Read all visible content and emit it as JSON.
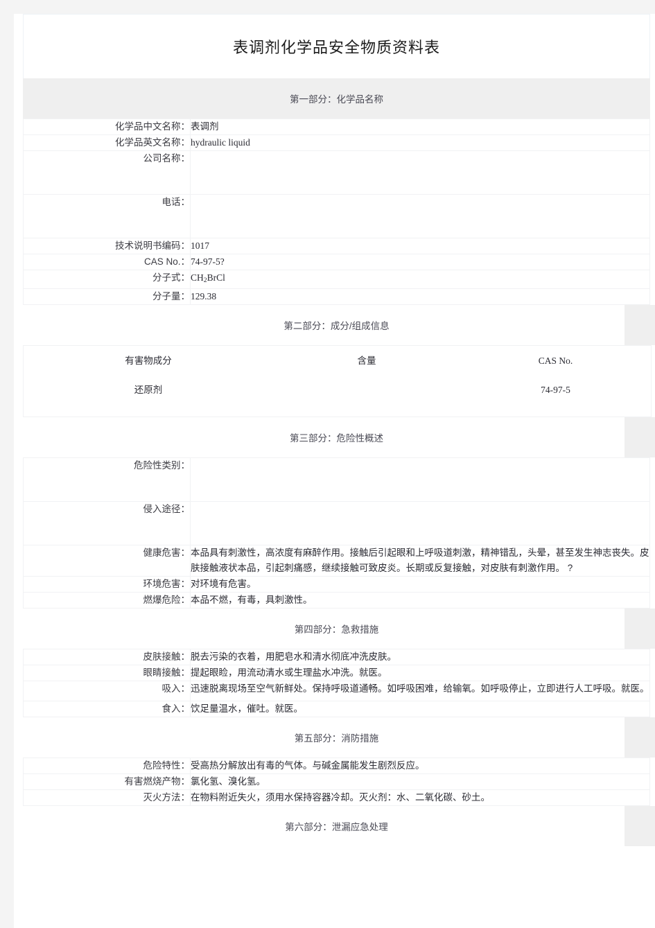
{
  "document": {
    "title": "表调剂化学品安全物质资料表"
  },
  "sections": [
    {
      "heading": "第一部分：化学品名称",
      "style": "filled",
      "rows": [
        {
          "label": "化学品中文名称：",
          "value": "表调剂",
          "size": "short",
          "latin": false
        },
        {
          "label": "化学品英文名称：",
          "value": "hydraulic  liquid",
          "size": "short",
          "latin": true
        },
        {
          "label": "公司名称：",
          "value": "",
          "size": "tall",
          "latin": false
        },
        {
          "label": "电话：",
          "value": "",
          "size": "tall",
          "latin": false
        },
        {
          "label": "技术说明书编码：",
          "value": "1017",
          "size": "short",
          "latin": true
        },
        {
          "label": "CAS  No.：",
          "value": "74-97-5?",
          "size": "short",
          "latin": true
        },
        {
          "label": "分子式：",
          "value": "CH2BrCl",
          "size": "short",
          "latin": true,
          "formula": true
        },
        {
          "label": "分子量：",
          "value": "129.38",
          "size": "short",
          "latin": true
        }
      ]
    },
    {
      "heading": "第二部分：成分/组成信息",
      "style": "plain",
      "composition": {
        "headers": [
          "有害物成分",
          "含量",
          "CAS  No."
        ],
        "rows": [
          {
            "name": "还原剂",
            "amount": "",
            "cas": "74-97-5"
          }
        ]
      }
    },
    {
      "heading": "第三部分：危险性概述",
      "style": "plain",
      "rows": [
        {
          "label": "危险性类别：",
          "value": "",
          "size": "tall",
          "latin": false
        },
        {
          "label": "侵入途径：",
          "value": "",
          "size": "tall",
          "latin": false
        },
        {
          "label": "健康危害：",
          "value": "本品具有刺激性，高浓度有麻醉作用。接触后引起眼和上呼吸道刺激，精神错乱，头晕，甚至发生神志丧失。皮肤接触液状本品，引起刺痛感，继续接触可致皮炎。长期或反复接触，对皮肤有刺激作用。 ?",
          "size": "mid",
          "latin": false
        },
        {
          "label": "环境危害：",
          "value": "对环境有危害。",
          "size": "short",
          "latin": false
        },
        {
          "label": "燃爆危险：",
          "value": "本品不燃，有毒，具刺激性。",
          "size": "short",
          "latin": false
        }
      ]
    },
    {
      "heading": "第四部分：急救措施",
      "style": "plain",
      "rows": [
        {
          "label": "皮肤接触：",
          "value": "脱去污染的衣着，用肥皂水和清水彻底冲洗皮肤。",
          "size": "short",
          "latin": false
        },
        {
          "label": "眼睛接触：",
          "value": "提起眼睑，用流动清水或生理盐水冲洗。就医。",
          "size": "short",
          "latin": false
        },
        {
          "label": "吸入：",
          "value": "迅速脱离现场至空气新鲜处。保持呼吸道通畅。如呼吸困难，给输氧。如呼吸停止，立即进行人工呼吸。就医。",
          "size": "mid",
          "latin": false
        },
        {
          "label": "食入：",
          "value": "饮足量温水，催吐。就医。",
          "size": "short",
          "latin": false
        }
      ]
    },
    {
      "heading": "第五部分：消防措施",
      "style": "plain",
      "rows": [
        {
          "label": "危险特性：",
          "value": "受高热分解放出有毒的气体。与碱金属能发生剧烈反应。",
          "size": "short",
          "latin": false
        },
        {
          "label": "有害燃烧产物：",
          "value": "氯化氢、溴化氢。",
          "size": "short",
          "latin": false
        },
        {
          "label": "灭火方法：",
          "value": "在物料附近失火，须用水保持容器冷却。灭火剂：水、二氧化碳、砂土。",
          "size": "short",
          "latin": false
        }
      ]
    },
    {
      "heading": "第六部分：泄漏应急处理",
      "style": "plain",
      "rows": []
    }
  ],
  "colors": {
    "page_background": "#f4f4f4",
    "paper": "#ffffff",
    "band_gray": "#efefef",
    "border": "#f1f2f4",
    "text": "#2b2b33",
    "heading_text": "#4a4a55"
  }
}
